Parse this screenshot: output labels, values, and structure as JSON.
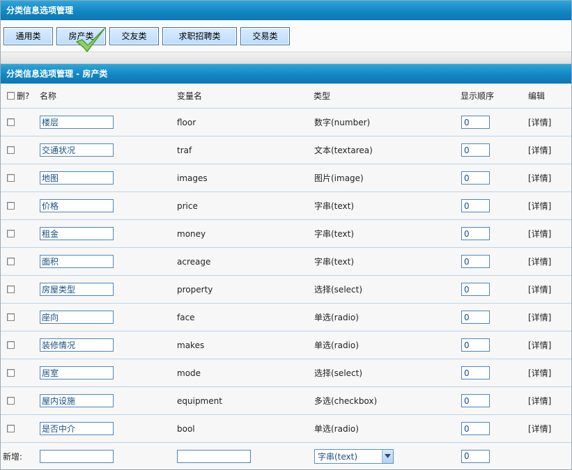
{
  "top_title": "分类信息选项管理",
  "tabs": [
    {
      "label": "通用类"
    },
    {
      "label": "房产类"
    },
    {
      "label": "交友类"
    },
    {
      "label": "求职招聘类"
    },
    {
      "label": "交易类"
    }
  ],
  "active_tab_index": 1,
  "section_title": "分类信息选项管理  - 房产类",
  "columns": {
    "delete": "删?",
    "name": "名称",
    "var": "变量名",
    "type": "类型",
    "order": "显示顺序",
    "edit": "编辑"
  },
  "rows": [
    {
      "name": "楼层",
      "var": "floor",
      "type": "数字(number)",
      "order": "0",
      "edit": "[详情]"
    },
    {
      "name": "交通状况",
      "var": "traf",
      "type": "文本(textarea)",
      "order": "0",
      "edit": "[详情]"
    },
    {
      "name": "地图",
      "var": "images",
      "type": "图片(image)",
      "order": "0",
      "edit": "[详情]"
    },
    {
      "name": "价格",
      "var": "price",
      "type": "字串(text)",
      "order": "0",
      "edit": "[详情]"
    },
    {
      "name": "租金",
      "var": "money",
      "type": "字串(text)",
      "order": "0",
      "edit": "[详情]"
    },
    {
      "name": "面积",
      "var": "acreage",
      "type": "字串(text)",
      "order": "0",
      "edit": "[详情]"
    },
    {
      "name": "房屋类型",
      "var": "property",
      "type": "选择(select)",
      "order": "0",
      "edit": "[详情]"
    },
    {
      "name": "座向",
      "var": "face",
      "type": "单选(radio)",
      "order": "0",
      "edit": "[详情]"
    },
    {
      "name": "装修情况",
      "var": "makes",
      "type": "单选(radio)",
      "order": "0",
      "edit": "[详情]"
    },
    {
      "name": "居室",
      "var": "mode",
      "type": "选择(select)",
      "order": "0",
      "edit": "[详情]"
    },
    {
      "name": "屋内设施",
      "var": "equipment",
      "type": "多选(checkbox)",
      "order": "0",
      "edit": "[详情]"
    },
    {
      "name": "是否中介",
      "var": "bool",
      "type": "单选(radio)",
      "order": "0",
      "edit": "[详情]"
    }
  ],
  "new_row": {
    "label": "新增:",
    "name_value": "",
    "var_value": "",
    "type_selected": "字串(text)",
    "order_value": "0"
  }
}
